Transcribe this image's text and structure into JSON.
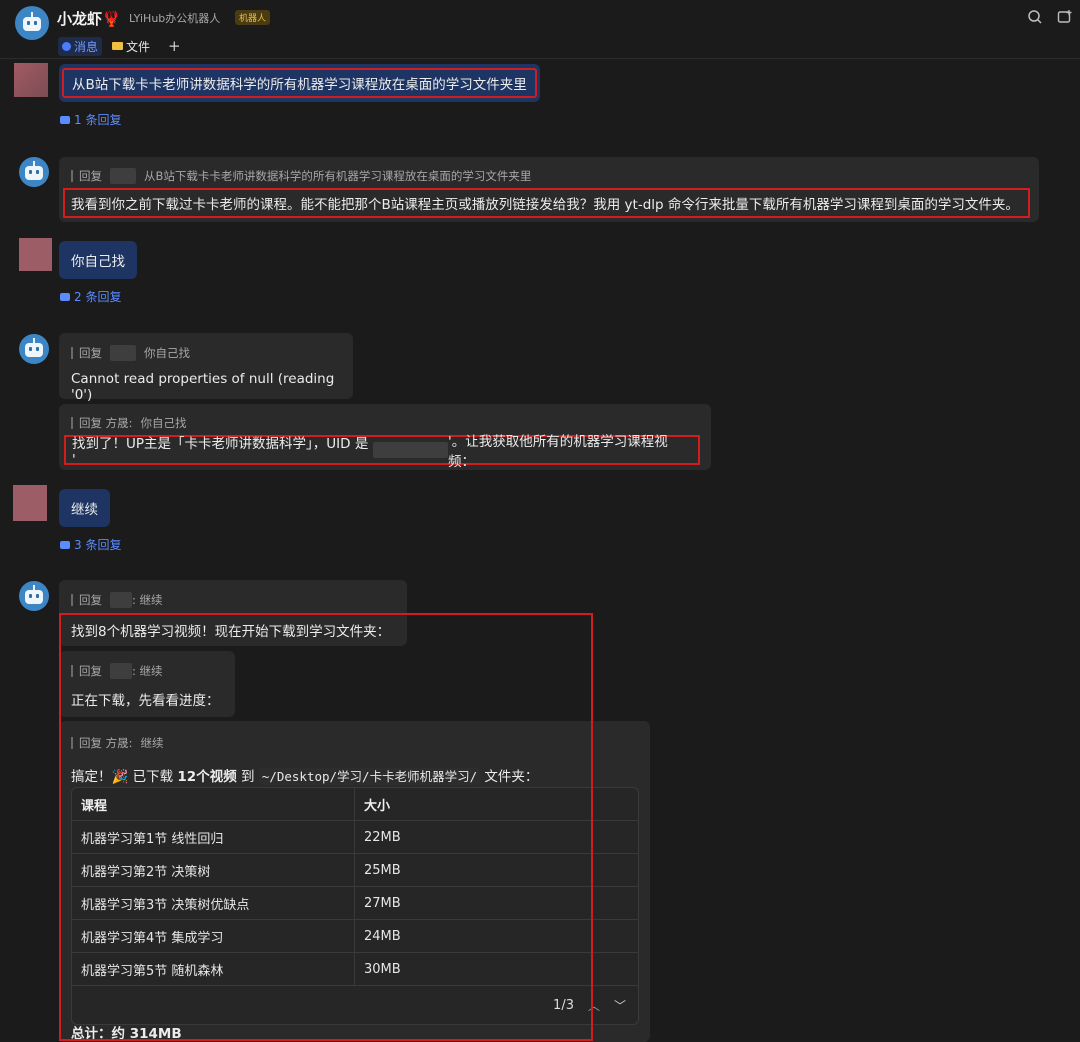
{
  "header": {
    "title": "小龙虾🦞",
    "subtitle": "LYiHub办公机器人",
    "badge": "机器人",
    "tabs": [
      {
        "label": "消息",
        "active": true
      },
      {
        "label": "文件",
        "active": false
      }
    ],
    "add_tab": "+"
  },
  "messages": {
    "m1": {
      "text": "从B站下载卡卡老师讲数据科学的所有机器学习课程放在桌面的学习文件夹里",
      "replies": "1 条回复"
    },
    "m2": {
      "quote_prefix": "回复",
      "quote_text": "从B站下载卡卡老师讲数据科学的所有机器学习课程放在桌面的学习文件夹里",
      "text": "我看到你之前下载过卡卡老师的课程。能不能把那个B站课程主页或播放列链接发给我？我用 yt-dlp 命令行来批量下载所有机器学习课程到桌面的学习文件夹。"
    },
    "m3": {
      "text": "你自己找",
      "replies": "2 条回复"
    },
    "m4": {
      "quote_prefix": "回复",
      "quote_text": "你自己找",
      "text": "Cannot read properties of null (reading '0')"
    },
    "m5": {
      "quote_prefix": "回复 方晟:",
      "quote_text": "你自己找",
      "text_a": "找到了！UP主是「卡卡老师讲数据科学」，UID 是 '",
      "text_b": "'。让我获取他所有的机器学习课程视频："
    },
    "m6": {
      "text": "继续",
      "replies": "3 条回复"
    },
    "m7": {
      "quote_prefix": "回复",
      "quote_text": ": 继续",
      "text": "找到8个机器学习视频！现在开始下载到学习文件夹："
    },
    "m8": {
      "quote_prefix": "回复",
      "quote_text": ": 继续",
      "text": "正在下载，先看看进度："
    },
    "m9": {
      "quote_prefix": "回复 方晟:",
      "quote_text": "继续",
      "done_a": "搞定！🎉 已下载",
      "done_bold": "12个视频",
      "done_b": "到",
      "path": "~/Desktop/学习/卡卡老师机器学习/",
      "done_c": "文件夹：",
      "table": {
        "headers": [
          "课程",
          "大小"
        ],
        "rows": [
          [
            "机器学习第1节 线性回归",
            "22MB"
          ],
          [
            "机器学习第2节 决策树",
            "25MB"
          ],
          [
            "机器学习第3节 决策树优缺点",
            "27MB"
          ],
          [
            "机器学习第4节 集成学习",
            "24MB"
          ],
          [
            "机器学习第5节 随机森林",
            "30MB"
          ]
        ],
        "page": "1/3"
      },
      "total": "总计：约 314MB"
    }
  },
  "icons": [
    "bot-icon",
    "search-icon",
    "new-chat-icon",
    "reply-icon",
    "chevron-up-icon",
    "chevron-down-icon"
  ],
  "colors": {
    "accent": "#5c8bff",
    "user_bubble": "#1e3563",
    "highlight": "#d01e1e"
  }
}
